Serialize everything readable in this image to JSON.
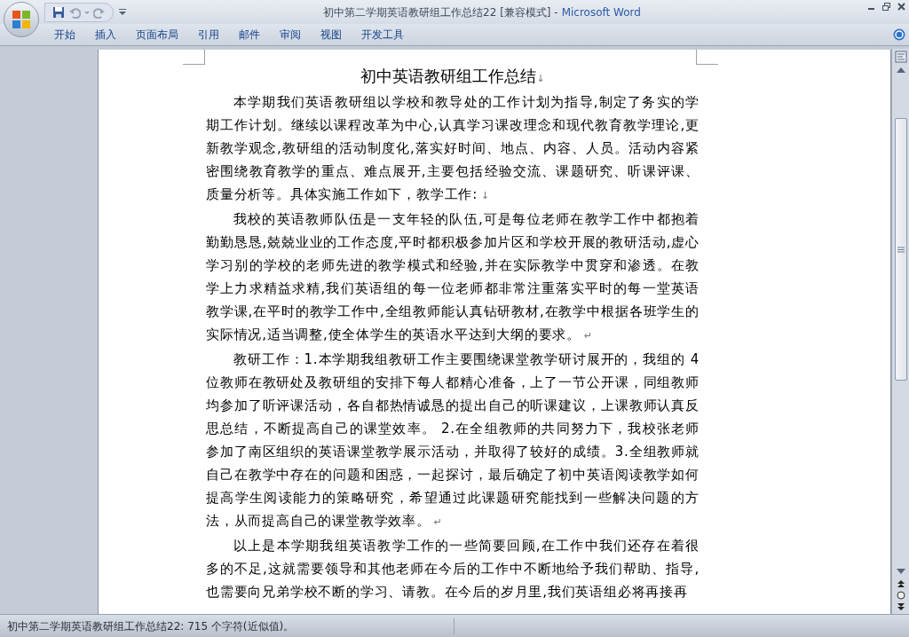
{
  "window": {
    "title": "初中第二学期英语教研组工作总结22 [兼容模式] -",
    "app": "Microsoft Word"
  },
  "ribbon_tabs": [
    {
      "label": "开始",
      "selected": false
    },
    {
      "label": "插入",
      "selected": false
    },
    {
      "label": "页面布局",
      "selected": false
    },
    {
      "label": "引用",
      "selected": false
    },
    {
      "label": "邮件",
      "selected": false
    },
    {
      "label": "审阅",
      "selected": false
    },
    {
      "label": "视图",
      "selected": false
    },
    {
      "label": "开发工具",
      "selected": false
    }
  ],
  "document": {
    "title": "初中英语教研组工作总结",
    "title_mark": "↓",
    "paragraphs": [
      {
        "text": "本学期我们英语教研组以学校和教导处的工作计划为指导,制定了务实的学期工作计划。继续以课程改革为中心,认真学习课改理念和现代教育教学理论,更新教学观念,教研组的活动制度化,落实好时间、地点、内容、人员。活动内容紧密围绕教育教学的重点、难点展开,主要包括经验交流、课题研究、听课评课、质量分析等。具体实施工作如下，教学工作:",
        "mark": "↓"
      },
      {
        "text": "我校的英语教师队伍是一支年轻的队伍,可是每位老师在教学工作中都抱着勤勤恳恳,兢兢业业的工作态度,平时都积极参加片区和学校开展的教研活动,虚心学习别的学校的老师先进的教学模式和经验,并在实际教学中贯穿和渗透。在教学上力求精益求精,我们英语组的每一位老师都非常注重落实平时的每一堂英语教学课,在平时的教学工作中,全组教师能认真钻研教材,在教学中根据各班学生的实际情况,适当调整,使全体学生的英语水平达到大纲的要求。",
        "mark": "↵"
      },
      {
        "text": "教研工作：1.本学期我组教研工作主要围绕课堂教学研讨展开的，我组的 4 位教师在教研处及教研组的安排下每人都精心准备，上了一节公开课，同组教师均参加了听评课活动，各自都热情诚恳的提出自己的听课建议，上课教师认真反思总结，不断提高自己的课堂效率。 2.在全组教师的共同努力下，我校张老师参加了南区组织的英语课堂教学展示活动，并取得了较好的成绩。3.全组教师就自己在教学中存在的问题和困惑，一起探讨，最后确定了初中英语阅读教学如何提高学生阅读能力的策略研究，希望通过此课题研究能找到一些解决问题的方法，从而提高自己的课堂教学效率。",
        "mark": "↵"
      },
      {
        "text": "以上是本学期我组英语教学工作的一些简要回顾,在工作中我们还存在着很多的不足,这就需要领导和其他老师在今后的工作中不断地给予我们帮助、指导,也需要向兄弟学校不断的学习、请教。在今后的岁月里,我们英语组必将再接再"
      }
    ]
  },
  "status_bar": {
    "text": "初中第二学期英语教研组工作总结22: 715 个字符(近似值)。"
  }
}
